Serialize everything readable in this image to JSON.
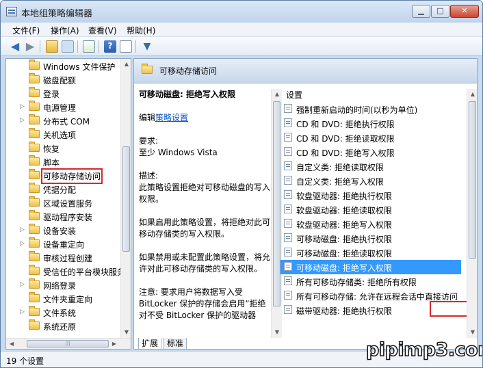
{
  "window": {
    "title": "本地组策略编辑器",
    "minimize": "▁",
    "maximize": "□",
    "close": "✕"
  },
  "menu": [
    "文件(F)",
    "操作(A)",
    "查看(V)",
    "帮助(H)"
  ],
  "toolbar_icons": [
    "back-arrow-icon",
    "forward-arrow-icon",
    "up-folder-icon",
    "show-hide-tree-icon",
    "export-list-icon",
    "help-icon",
    "properties-icon",
    "filter-icon"
  ],
  "tree": {
    "items": [
      {
        "label": "Windows 文件保护",
        "expandable": false
      },
      {
        "label": "磁盘配额",
        "expandable": false
      },
      {
        "label": "登录",
        "expandable": false
      },
      {
        "label": "电源管理",
        "expandable": true
      },
      {
        "label": "分布式 COM",
        "expandable": true
      },
      {
        "label": "关机选项",
        "expandable": false
      },
      {
        "label": "恢复",
        "expandable": false
      },
      {
        "label": "脚本",
        "expandable": false
      },
      {
        "label": "可移动存储访问",
        "expandable": false,
        "selected": true
      },
      {
        "label": "凭据分配",
        "expandable": false
      },
      {
        "label": "区域设置服务",
        "expandable": false
      },
      {
        "label": "驱动程序安装",
        "expandable": false
      },
      {
        "label": "设备安装",
        "expandable": true
      },
      {
        "label": "设备重定向",
        "expandable": true
      },
      {
        "label": "审核过程创建",
        "expandable": false
      },
      {
        "label": "受信任的平台模块服务",
        "expandable": false
      },
      {
        "label": "网络登录",
        "expandable": true
      },
      {
        "label": "文件夹重定向",
        "expandable": false
      },
      {
        "label": "文件系统",
        "expandable": true
      },
      {
        "label": "系统还原",
        "expandable": false
      }
    ]
  },
  "pane": {
    "header": "可移动存储访问",
    "desc": {
      "title": "可移动磁盘: 拒绝写入权限",
      "edit_prefix": "编辑",
      "edit_link": "策略设置",
      "req_label": "要求:",
      "req_value": "至少 Windows Vista",
      "desc_label": "描述:",
      "desc_p1": "此策略设置拒绝对可移动磁盘的写入权限。",
      "desc_p2": "如果启用此策略设置，将拒绝对此可移动存储类的写入权限。",
      "desc_p3": "如果禁用或未配置此策略设置，将允许对此可移动存储类的写入权限。",
      "desc_p4": "注意: 要求用户将数据写入受 BitLocker 保护的存储会启用“拒绝对不受 BitLocker 保护的驱动器"
    },
    "settings_header": "设置",
    "settings": [
      "强制重新启动的时间(以秒为单位)",
      "CD 和 DVD: 拒绝执行权限",
      "CD 和 DVD: 拒绝读取权限",
      "CD 和 DVD: 拒绝写入权限",
      "自定义类: 拒绝读取权限",
      "自定义类: 拒绝写入权限",
      "软盘驱动器: 拒绝执行权限",
      "软盘驱动器: 拒绝读取权限",
      "软盘驱动器: 拒绝写入权限",
      "可移动磁盘: 拒绝执行权限",
      "可移动磁盘: 拒绝读取权限",
      "可移动磁盘: 拒绝写入权限",
      "所有可移动存储类: 拒绝所有权限",
      "所有可移动存储: 允许在远程会话中直接访问",
      "磁带驱动器: 拒绝执行权限"
    ],
    "selected_setting": 11,
    "tabs": [
      "扩展",
      "标准"
    ]
  },
  "status": "19 个设置",
  "watermark": "pipimp3.com"
}
